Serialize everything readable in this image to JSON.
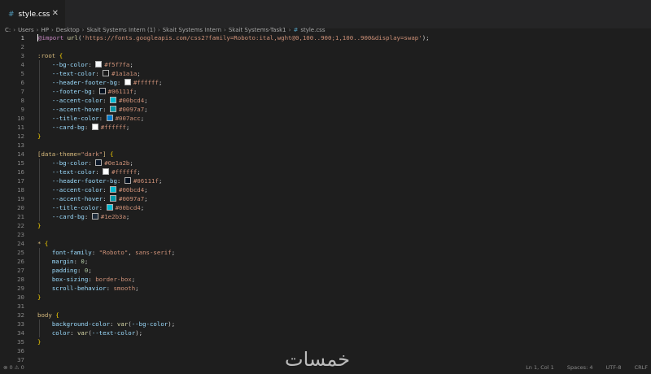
{
  "tab": {
    "icon": "css-hash-icon",
    "name": "style.css",
    "close_icon": "close-icon"
  },
  "breadcrumb": [
    "C:",
    "Users",
    "HP",
    "Desktop",
    "Skait Systems Intern (1)",
    "Skait Systems Intern",
    "Skait Systems-Task1",
    "style.css"
  ],
  "swatches": {
    "f5f7fa": "#f5f7fa",
    "1a1a1a": "#1a1a1a",
    "ffffff": "#ffffff",
    "06111f": "#06111f",
    "00bcd4": "#00bcd4",
    "0097a7": "#0097a7",
    "007acc": "#007acc",
    "0e1a2b": "#0e1a2b",
    "1e2b3a": "#1e2b3a"
  },
  "code": [
    "@import url('https://fonts.googleapis.com/css2?family=Roboto:ital,wght@0,100..900;1,100..900&display=swap');",
    "",
    ":root {",
    "    --bg-color: #f5f7fa;",
    "    --text-color: #1a1a1a;",
    "    --header-footer-bg: #ffffff;",
    "    --footer-bg: #06111f;",
    "    --accent-color: #00bcd4;",
    "    --accent-hover: #0097a7;",
    "    --title-color: #007acc;",
    "    --card-bg: #ffffff;",
    "}",
    "",
    "[data-theme=\"dark\"] {",
    "    --bg-color: #0e1a2b;",
    "    --text-color: #ffffff;",
    "    --header-footer-bg: #06111f;",
    "    --accent-color: #00bcd4;",
    "    --accent-hover: #0097a7;",
    "    --title-color: #00bcd4;",
    "    --card-bg: #1e2b3a;",
    "}",
    "",
    "* {",
    "    font-family: \"Roboto\", sans-serif;",
    "    margin: 0;",
    "    padding: 0;",
    "    box-sizing: border-box;",
    "    scroll-behavior: smooth;",
    "}",
    "",
    "body {",
    "    background-color: var(--bg-color);",
    "    color: var(--text-color);",
    "}",
    "",
    ""
  ],
  "line_numbers": [
    "1",
    "2",
    "3",
    "4",
    "5",
    "6",
    "7",
    "8",
    "9",
    "10",
    "11",
    "12",
    "13",
    "14",
    "15",
    "16",
    "17",
    "18",
    "19",
    "20",
    "21",
    "22",
    "23",
    "24",
    "25",
    "26",
    "27",
    "28",
    "29",
    "30",
    "31",
    "32",
    "33",
    "34",
    "35",
    "36",
    "37"
  ],
  "status": {
    "left": "⊗ 0 ⚠ 0",
    "cursor": "Ln 1, Col 1",
    "spaces": "Spaces: 4",
    "encoding": "UTF-8",
    "eol": "CRLF"
  },
  "watermark": "خمسات"
}
